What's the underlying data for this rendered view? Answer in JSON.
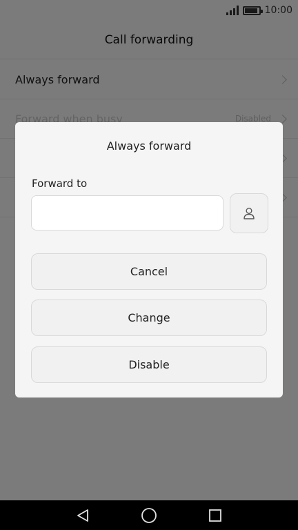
{
  "status_bar": {
    "time": "10:00",
    "icons": [
      "signal-icon",
      "battery-icon"
    ],
    "battery_level": 0.9
  },
  "header": {
    "title": "Call forwarding"
  },
  "list": {
    "items": [
      {
        "label": "Always forward",
        "value": ""
      },
      {
        "label": "Forward when busy",
        "value": "Disabled"
      },
      {
        "label": "",
        "value": ""
      },
      {
        "label": "",
        "value": ""
      }
    ]
  },
  "dialog": {
    "title": "Always forward",
    "field_label": "Forward to",
    "field_value": "",
    "field_placeholder": "",
    "contact_icon": "person-icon",
    "buttons": {
      "cancel": "Cancel",
      "change": "Change",
      "disable": "Disable"
    }
  },
  "nav_bar": {
    "icons": [
      "back-icon",
      "home-icon",
      "recents-icon"
    ]
  },
  "colors": {
    "dialog_bg": "#f5f5f5",
    "button_bg": "#f1f1f1",
    "dim_overlay": "rgba(0,0,0,0.5)",
    "nav_bar": "#000000"
  }
}
